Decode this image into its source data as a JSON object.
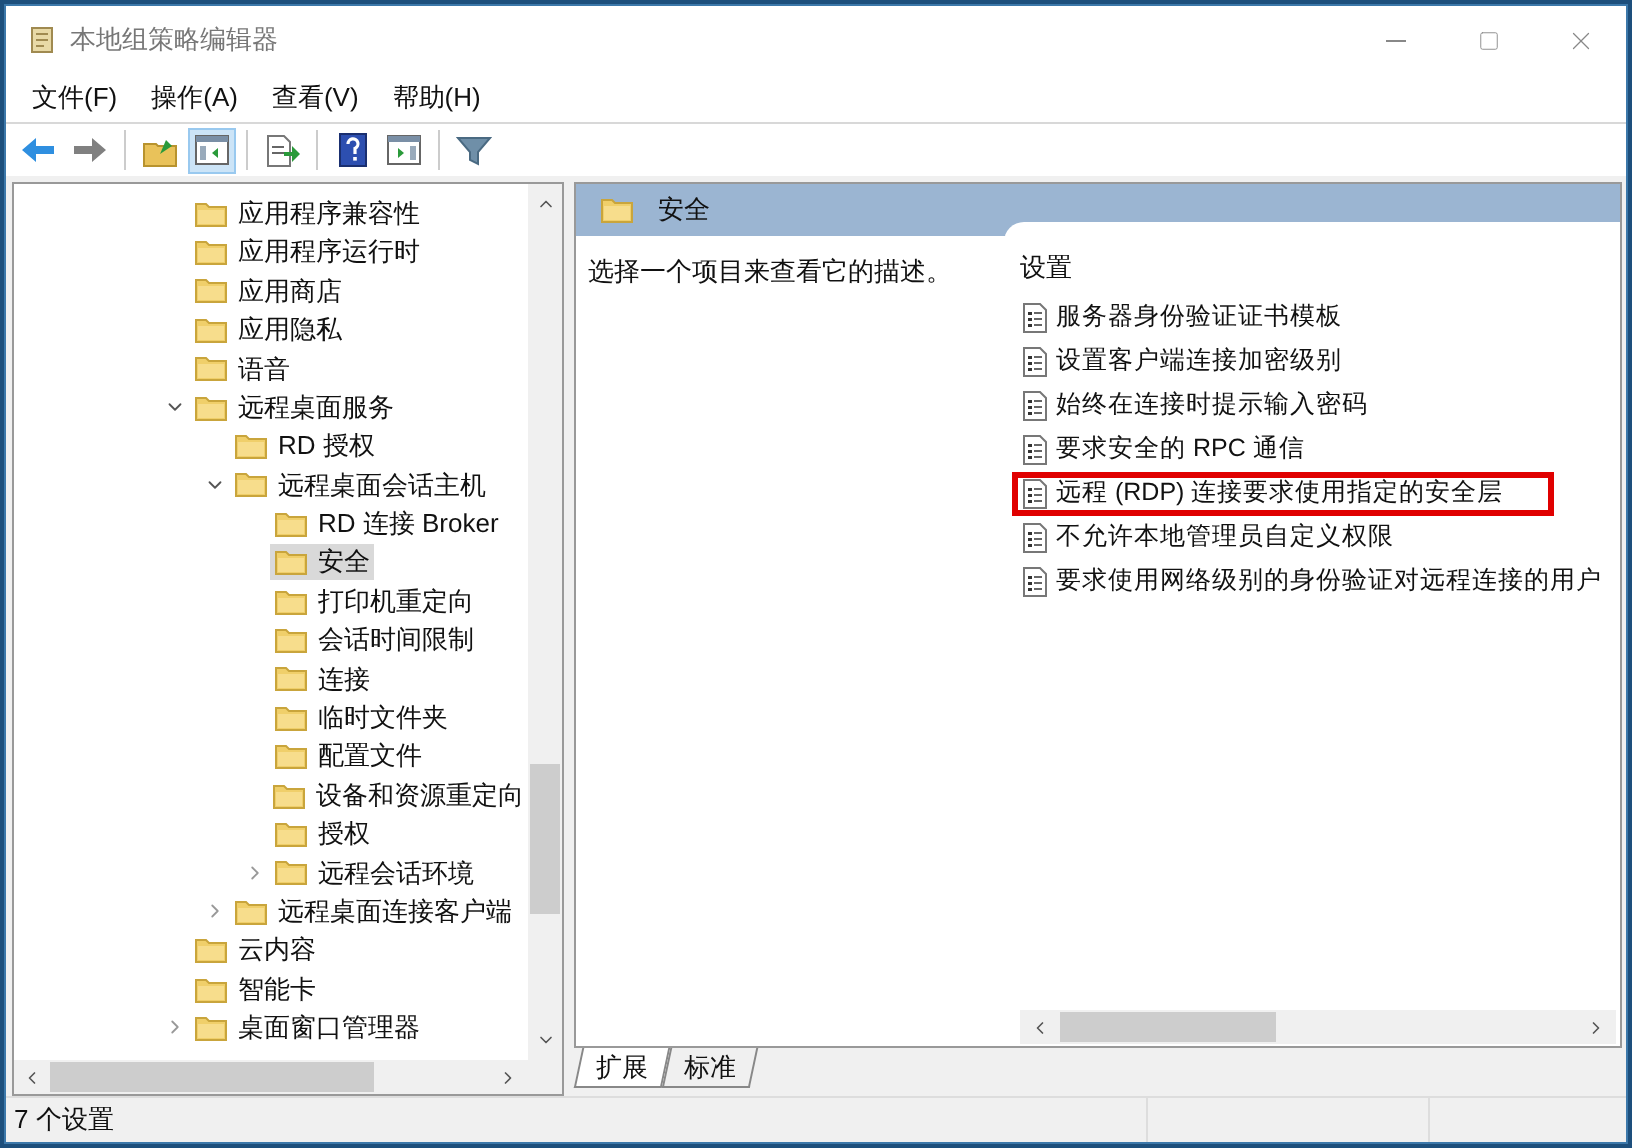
{
  "window": {
    "title": "本地组策略编辑器"
  },
  "menu": [
    "文件(F)",
    "操作(A)",
    "查看(V)",
    "帮助(H)"
  ],
  "toolbar": [
    {
      "kind": "back",
      "pressed": false
    },
    {
      "kind": "forward",
      "pressed": false
    },
    {
      "kind": "sep"
    },
    {
      "kind": "up",
      "pressed": false
    },
    {
      "kind": "tree",
      "pressed": true
    },
    {
      "kind": "sep"
    },
    {
      "kind": "export",
      "pressed": false
    },
    {
      "kind": "sep"
    },
    {
      "kind": "help",
      "pressed": false
    },
    {
      "kind": "pane",
      "pressed": false
    },
    {
      "kind": "sep"
    },
    {
      "kind": "filter",
      "pressed": false
    }
  ],
  "tree": [
    {
      "label": "应用程序兼容性",
      "selected": false
    },
    {
      "label": "应用程序运行时",
      "selected": false
    },
    {
      "label": "应用商店",
      "selected": false
    },
    {
      "label": "应用隐私",
      "selected": false
    },
    {
      "label": "语音",
      "selected": false
    },
    {
      "label": "远程桌面服务",
      "selected": false,
      "expanded": true,
      "children": [
        {
          "label": "RD 授权",
          "selected": false
        },
        {
          "label": "远程桌面会话主机",
          "selected": false,
          "expanded": true,
          "children": [
            {
              "label": "RD 连接 Broker",
              "selected": false
            },
            {
              "label": "安全",
              "selected": true
            },
            {
              "label": "打印机重定向",
              "selected": false
            },
            {
              "label": "会话时间限制",
              "selected": false
            },
            {
              "label": "连接",
              "selected": false
            },
            {
              "label": "临时文件夹",
              "selected": false
            },
            {
              "label": "配置文件",
              "selected": false
            },
            {
              "label": "设备和资源重定向",
              "selected": false
            },
            {
              "label": "授权",
              "selected": false
            },
            {
              "label": "远程会话环境",
              "selected": false,
              "expanded": false
            }
          ]
        },
        {
          "label": "远程桌面连接客户端",
          "selected": false,
          "expanded": false
        }
      ]
    },
    {
      "label": "云内容",
      "selected": false
    },
    {
      "label": "智能卡",
      "selected": false
    },
    {
      "label": "桌面窗口管理器",
      "selected": false,
      "expanded": false
    }
  ],
  "details": {
    "title": "安全",
    "description": "选择一个项目来查看它的描述。",
    "column": "设置",
    "settings": [
      {
        "label": "服务器身份验证证书模板",
        "highlighted": false
      },
      {
        "label": "设置客户端连接加密级别",
        "highlighted": false
      },
      {
        "label": "始终在连接时提示输入密码",
        "highlighted": false
      },
      {
        "label": "要求安全的 RPC 通信",
        "highlighted": false
      },
      {
        "label": "远程 (RDP) 连接要求使用指定的安全层",
        "highlighted": true
      },
      {
        "label": "不允许本地管理员自定义权限",
        "highlighted": false
      },
      {
        "label": "要求使用网络级别的身份验证对远程连接的用户",
        "highlighted": false
      }
    ]
  },
  "tabs": [
    {
      "label": "扩展",
      "selected": true
    },
    {
      "label": "标准",
      "selected": false
    }
  ],
  "status_bar": "7 个设置"
}
